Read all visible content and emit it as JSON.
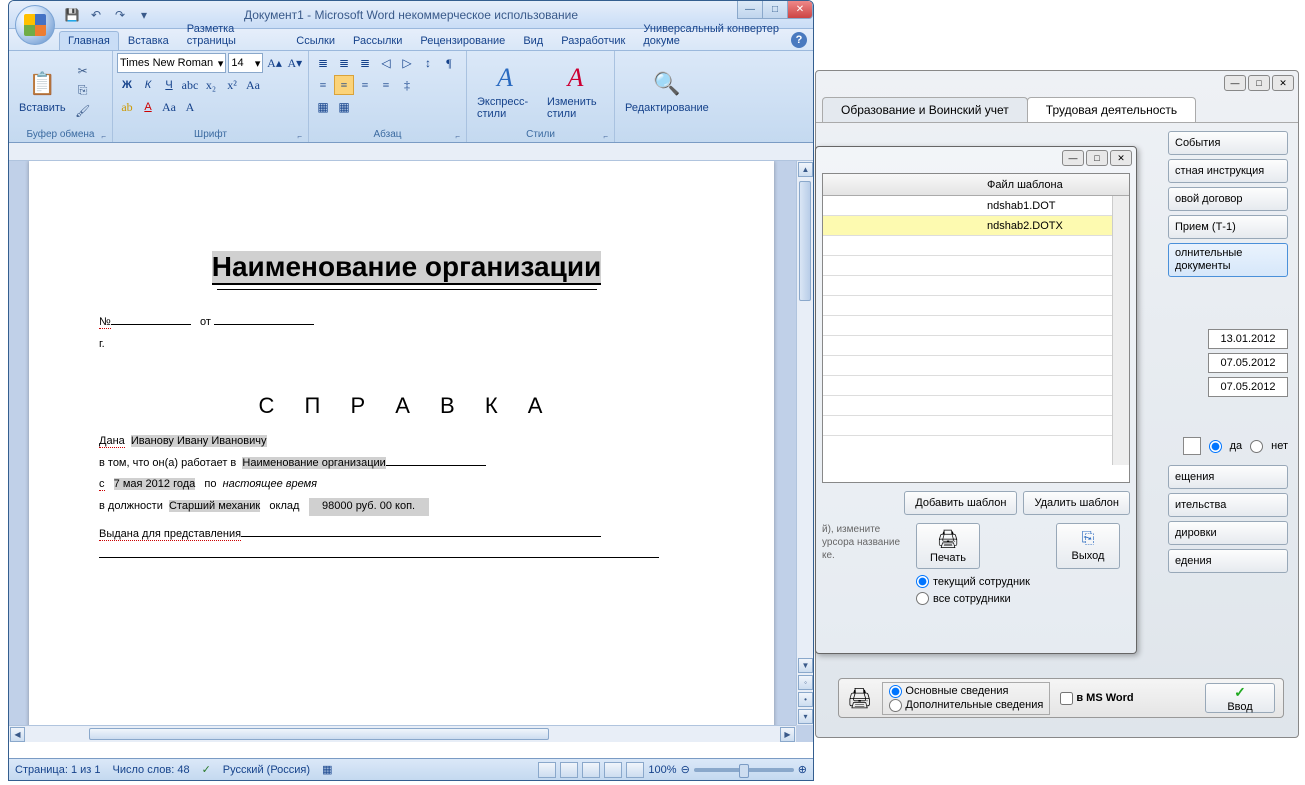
{
  "word": {
    "title": "Документ1 - Microsoft Word некоммерческое использование",
    "tabs": [
      "Главная",
      "Вставка",
      "Разметка страницы",
      "Ссылки",
      "Рассылки",
      "Рецензирование",
      "Вид",
      "Разработчик",
      "Универсальный конвертер докуме"
    ],
    "font_name": "Times New Roman",
    "font_size": "14",
    "groups": {
      "clipboard": "Буфер обмена",
      "font": "Шрифт",
      "para": "Абзац",
      "styles": "Стили",
      "edit": "Редактирование"
    },
    "big_buttons": {
      "paste": "Вставить",
      "express": "Экспресс-стили",
      "change": "Изменить стили",
      "edit": "Редактирование"
    },
    "status": {
      "page": "Страница: 1 из 1",
      "words": "Число слов: 48",
      "lang": "Русский (Россия)",
      "zoom": "100%"
    }
  },
  "doc": {
    "org_title": "Наименование организации",
    "num_label": "№",
    "from_label": "от",
    "year_label": "г.",
    "heading": "С П Р А В К А",
    "given": "Дана",
    "name": "Иванову Ивану Ивановичу",
    "works_in": "в том, что он(а) работает в",
    "org2": "Наименование организации",
    "from": "с",
    "date_from": "7 мая 2012 года",
    "to": "по",
    "date_to": "настоящее время",
    "pos_label": "в должности",
    "position": "Старший механик",
    "salary_label": "оклад",
    "salary": "98000 руб. 00 коп.",
    "issued": "Выдана для представления"
  },
  "back": {
    "tab1": "Образование и Воинский учет",
    "tab2": "Трудовая деятельность",
    "buttons": [
      "События",
      "стная инструкция",
      "овой  договор",
      "Прием (Т-1)",
      "олнительные документы"
    ],
    "dates": [
      "13.01.2012",
      "07.05.2012",
      "07.05.2012"
    ],
    "yes": "да",
    "no": "нет",
    "more": [
      "ещения",
      "ительства",
      "дировки",
      "едения"
    ]
  },
  "dlg": {
    "header": "Файл шаблона",
    "rows": [
      "ndshab1.DOT",
      "ndshab2.DOTX"
    ],
    "add": "Добавить шаблон",
    "del": "Удалить шаблон",
    "hint": "й), измените урсора название ке.",
    "print": "Печать",
    "exit": "Выход",
    "r1": "текущий сотрудник",
    "r2": "все сотрудники"
  },
  "footer": {
    "r1": "Основные сведения",
    "r2": "Дополнительные сведения",
    "msword": "в MS Word",
    "input": "Ввод"
  }
}
